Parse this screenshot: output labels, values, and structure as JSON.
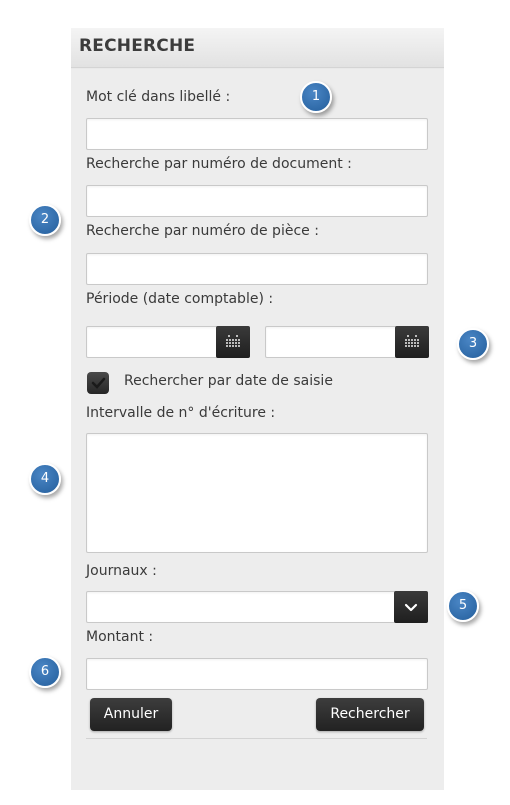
{
  "panel": {
    "title": "RECHERCHE"
  },
  "form": {
    "keyword_label": "Mot clé dans libellé :",
    "keyword_value": "",
    "docnum_label": "Recherche par numéro de document :",
    "docnum_value": "",
    "piece_label": "Recherche par numéro de pièce :",
    "piece_value": "",
    "period_label": "Période (date comptable) :",
    "period_start_value": "",
    "period_end_value": "",
    "calendar_icon": "calendar-icon",
    "entry_date_checkbox_label": "Rechercher par date de saisie",
    "entry_date_checked": true,
    "interval_label": "Intervalle de n° d'écriture :",
    "interval_value": "",
    "journals_label": "Journaux :",
    "journals_selected": "",
    "amount_label": "Montant :",
    "amount_value": ""
  },
  "buttons": {
    "cancel": "Annuler",
    "search": "Rechercher"
  },
  "callouts": [
    "1",
    "2",
    "3",
    "4",
    "5",
    "6"
  ],
  "colors": {
    "callout": "#2f6aa8",
    "button": "#2b2b2b",
    "panel": "#ededed"
  }
}
